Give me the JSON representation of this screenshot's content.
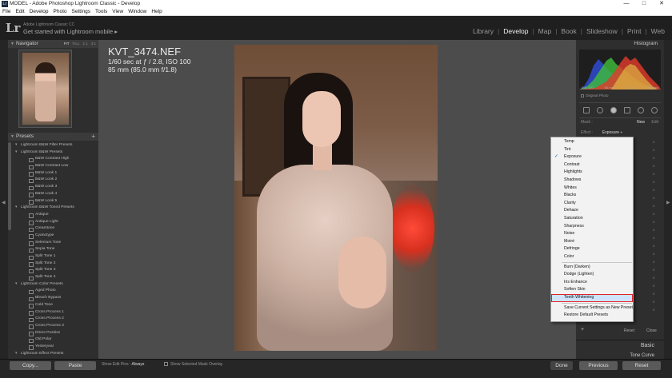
{
  "window": {
    "title": "MODEL - Adobe Photoshop Lightroom Classic - Develop",
    "icon_text": "Lr",
    "controls": [
      "—",
      "□",
      "✕"
    ]
  },
  "menubar": [
    "File",
    "Edit",
    "Develop",
    "Photo",
    "Settings",
    "Tools",
    "View",
    "Window",
    "Help"
  ],
  "identity": {
    "logo": "Lr",
    "subtitle": "Adobe Lightroom Classic CC",
    "main": "Get started with Lightroom mobile ▸"
  },
  "modules": [
    "Library",
    "Develop",
    "Map",
    "Book",
    "Slideshow",
    "Print",
    "Web"
  ],
  "active_module": "Develop",
  "navigator": {
    "title": "Navigator",
    "zoom_options": [
      "FIT",
      "FILL",
      "1:1",
      "3:1"
    ]
  },
  "presets": {
    "title": "Presets",
    "add": "+",
    "rows": [
      {
        "type": "folder",
        "label": "Lightroom B&W Filter Presets"
      },
      {
        "type": "folder",
        "label": "Lightroom B&W Presets"
      },
      {
        "type": "item",
        "label": "B&W Contrast High"
      },
      {
        "type": "item",
        "label": "B&W Contrast Low"
      },
      {
        "type": "item",
        "label": "B&W Look 1"
      },
      {
        "type": "item",
        "label": "B&W Look 2"
      },
      {
        "type": "item",
        "label": "B&W Look 3"
      },
      {
        "type": "item",
        "label": "B&W Look 4"
      },
      {
        "type": "item",
        "label": "B&W Look 5"
      },
      {
        "type": "folder",
        "label": "Lightroom B&W Toned Presets"
      },
      {
        "type": "item",
        "label": "Antique"
      },
      {
        "type": "item",
        "label": "Antique Light"
      },
      {
        "type": "item",
        "label": "Creamtone"
      },
      {
        "type": "item",
        "label": "Cyanotype"
      },
      {
        "type": "item",
        "label": "Selenium Tone"
      },
      {
        "type": "item",
        "label": "Sepia Tone"
      },
      {
        "type": "item",
        "label": "Split Tone 1"
      },
      {
        "type": "item",
        "label": "Split Tone 2"
      },
      {
        "type": "item",
        "label": "Split Tone 3"
      },
      {
        "type": "item",
        "label": "Split Tone 4"
      },
      {
        "type": "folder",
        "label": "Lightroom Color Presets"
      },
      {
        "type": "item",
        "label": "Aged Photo"
      },
      {
        "type": "item",
        "label": "Bleach Bypass"
      },
      {
        "type": "item",
        "label": "Cold Tone"
      },
      {
        "type": "item",
        "label": "Cross Process 1"
      },
      {
        "type": "item",
        "label": "Cross Process 2"
      },
      {
        "type": "item",
        "label": "Cross Process 3"
      },
      {
        "type": "item",
        "label": "Direct Positive"
      },
      {
        "type": "item",
        "label": "Old Polar"
      },
      {
        "type": "item",
        "label": "Yesteryear"
      },
      {
        "type": "folder",
        "label": "Lightroom Effect Presets"
      }
    ]
  },
  "photo_info": {
    "filename": "KVT_3474.NEF",
    "exposure": "1/60 sec at ƒ / 2.8, ISO 100",
    "lens": "85 mm (85.0 mm f/1.8)"
  },
  "toolbar": {
    "copy": "Copy...",
    "paste": "Paste",
    "edit_pins_label": "Show Edit Pins :",
    "edit_pins_value": "Always",
    "overlay_label": "Show Selected Mask Overlay",
    "done": "Done",
    "previous": "Previous",
    "reset": "Reset"
  },
  "histogram": {
    "title": "Histogram",
    "readout": [
      "ISO 100",
      "85 mm",
      "ƒ / 2.8",
      "1/60 sec"
    ],
    "original_photo": "Original Photo"
  },
  "mask": {
    "label": "Mask :",
    "new": "New",
    "edit": "Edit"
  },
  "effect": {
    "label": "Effect :",
    "value": "Exposure ÷"
  },
  "slider_ticks": [
    "0",
    "0",
    "0",
    "0",
    "0",
    "0",
    "0",
    "0",
    "0",
    "0",
    "0",
    "0",
    "0",
    "0",
    "0",
    "0",
    "0",
    "0",
    "0",
    "0",
    "0",
    "0"
  ],
  "right_footer": {
    "plus": "+",
    "reset": "Reset",
    "close": "Close"
  },
  "sections": {
    "basic": "Basic",
    "tone_curve": "Tone Curve"
  },
  "context_menu": {
    "groups": [
      [
        "Temp",
        "Tint",
        "Exposure",
        "Contrast",
        "Highlights",
        "Shadows",
        "Whites",
        "Blacks",
        "Clarity",
        "Dehaze",
        "Saturation",
        "Sharpness",
        "Noise",
        "Moiré",
        "Defringe",
        "Color"
      ],
      [
        "Burn (Darken)",
        "Dodge (Lighten)",
        "Iris Enhance",
        "Soften Skin",
        "Teeth Whitening"
      ],
      [
        "Save Current Settings as New Preset...",
        "Restore Default Presets"
      ]
    ],
    "checked": "Exposure",
    "highlighted": "Teeth Whitening",
    "check_mark": "✓"
  },
  "colors": {
    "accent_highlight": "#e0232b",
    "check": "#1a5bd6",
    "lamp": "#ff4a38"
  }
}
